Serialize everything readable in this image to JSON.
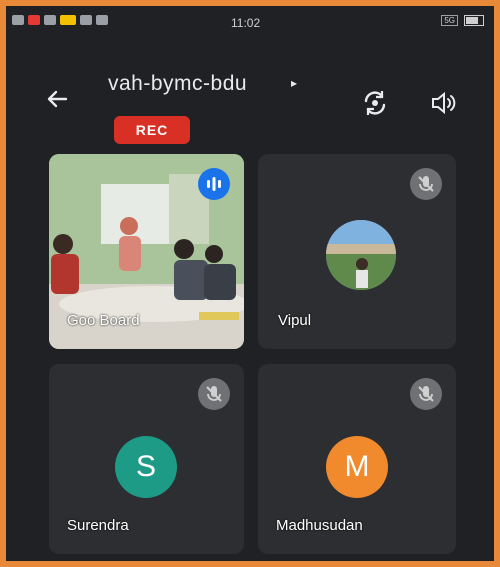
{
  "status_bar": {
    "time": "11:02",
    "network_label": "5G"
  },
  "meeting": {
    "code": "vah-bymc-bdu",
    "rec_label": "REC"
  },
  "participants": [
    {
      "name": "Goo Board",
      "video": true,
      "speaking": true
    },
    {
      "name": "Vipul",
      "muted": true,
      "photo_avatar": true
    },
    {
      "name": "Surendra",
      "muted": true,
      "initial": "S",
      "color": "#1e9b87"
    },
    {
      "name": "Madhusudan",
      "muted": true,
      "initial": "M",
      "color": "#f08a2c"
    }
  ],
  "colors": {
    "background": "#202124",
    "tile": "#2d2e31",
    "rec": "#d93025",
    "frame": "#e8893a"
  }
}
